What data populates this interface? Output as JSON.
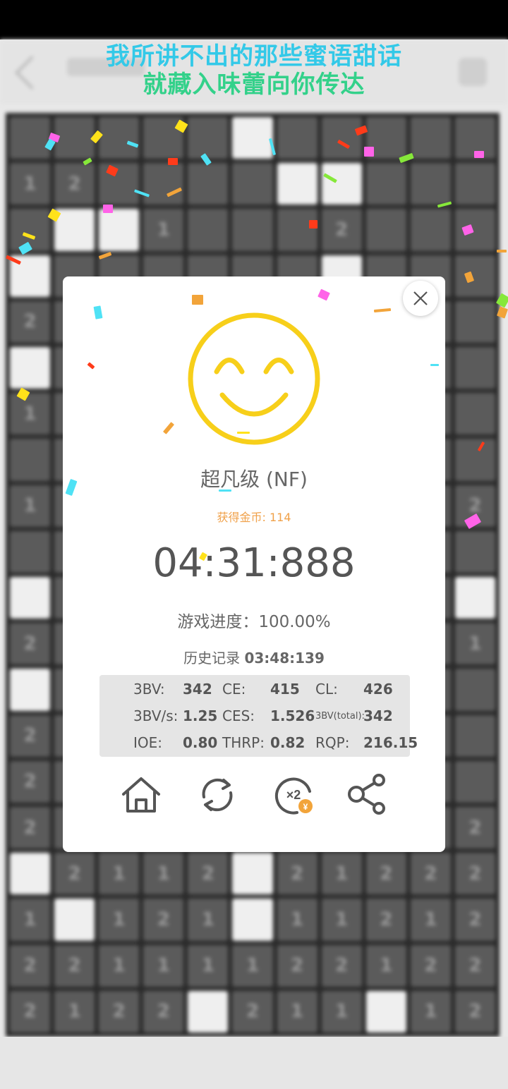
{
  "lyrics": {
    "line1": "我所讲不出的那些蜜语甜话",
    "line2": "就藏入味蕾向你传达"
  },
  "board": {
    "cells": [
      "",
      "",
      "",
      "",
      "",
      "open",
      "",
      "",
      "",
      "",
      "",
      "1",
      "2",
      "",
      "",
      "",
      "",
      "open",
      "open",
      "",
      "",
      "",
      "",
      "open",
      "open",
      "1",
      "",
      "",
      "",
      "2",
      "",
      "",
      "",
      "open",
      "",
      "",
      "",
      "",
      "",
      "",
      "open",
      "",
      "",
      "",
      "2",
      "",
      "",
      "",
      "",
      "",
      "",
      "",
      "",
      "",
      "",
      "open",
      "",
      "",
      "",
      "",
      "",
      "",
      "",
      "",
      "",
      "",
      "1",
      "",
      "",
      "",
      "",
      "",
      "",
      "",
      "",
      "",
      "",
      "",
      "",
      "",
      "",
      "",
      "",
      "",
      "",
      "",
      "",
      "",
      "1",
      "",
      "",
      "",
      "",
      "",
      "",
      "",
      "",
      "",
      "2",
      "",
      "",
      "",
      "",
      "",
      "",
      "",
      "",
      "",
      "",
      "",
      "open",
      "",
      "",
      "",
      "",
      "",
      "",
      "",
      "",
      "",
      "open",
      "2",
      "",
      "",
      "",
      "",
      "",
      "",
      "",
      "",
      "",
      "1",
      "open",
      "",
      "",
      "",
      "",
      "",
      "",
      "",
      "",
      "",
      "",
      "2",
      "",
      "",
      "",
      "",
      "",
      "",
      "",
      "",
      "",
      "",
      "2",
      "",
      "",
      "",
      "",
      "",
      "",
      "",
      "",
      "",
      "",
      "2",
      "2",
      "1",
      "1",
      "2",
      "2",
      "1",
      "1",
      "1",
      "2",
      "2",
      "open",
      "2",
      "1",
      "1",
      "2",
      "open",
      "2",
      "1",
      "2",
      "2",
      "2",
      "1",
      "open",
      "1",
      "2",
      "1",
      "open",
      "1",
      "1",
      "2",
      "1",
      "2",
      "2",
      "2",
      "1",
      "1",
      "1",
      "1",
      "2",
      "2",
      "1",
      "2",
      "2",
      "2",
      "1",
      "2",
      "2",
      "open",
      "2",
      "1",
      "1",
      "open",
      "1",
      "2"
    ]
  },
  "dialog": {
    "rank": "超凡级 (NF)",
    "coins_label": "获得金币: 114",
    "time": "04:31:888",
    "progress": "游戏进度：100.00%",
    "record_label": "历史记录",
    "record_value": "03:48:139",
    "stats": {
      "bv_label": "3BV:",
      "bv": "342",
      "ce_label": "CE:",
      "ce": "415",
      "cl_label": "CL:",
      "cl": "426",
      "bvs_label": "3BV/s:",
      "bvs": "1.25",
      "ces_label": "CES:",
      "ces": "1.526",
      "bvtotal_label": "3BV(total):",
      "bvtotal": "342",
      "ioe_label": "IOE:",
      "ioe": "0.80",
      "thrp_label": "THRP:",
      "thrp": "0.82",
      "rqp_label": "RQP:",
      "rqp": "216.15"
    },
    "double_label": "×2",
    "coin_symbol": "¥"
  },
  "colors": {
    "smiley": "#f7cf1a",
    "coins_text": "#f0a14a",
    "lyric1": "#33c9e8",
    "lyric2": "#33d18a"
  },
  "icons": [
    "close-icon",
    "smiley-icon",
    "home-icon",
    "refresh-icon",
    "double-coins-icon",
    "share-icon"
  ]
}
